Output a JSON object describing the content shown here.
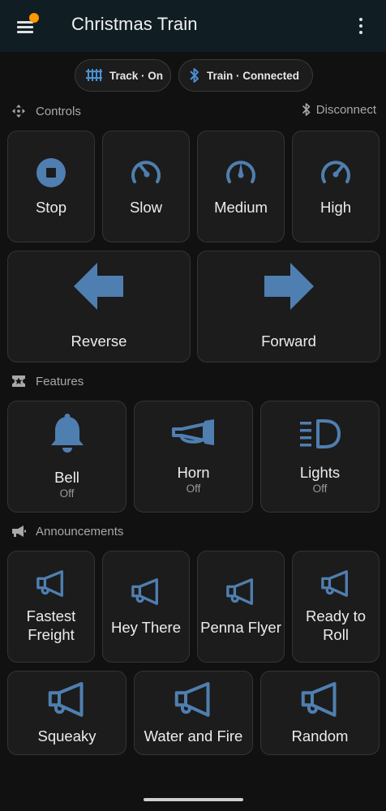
{
  "header": {
    "title": "Christmas Train"
  },
  "chips": {
    "track": {
      "label": "Track · On",
      "icon": "track-icon"
    },
    "train": {
      "label": "Train · Connected",
      "icon": "bluetooth-icon"
    }
  },
  "sections": {
    "controls": {
      "label": "Controls",
      "action": "Disconnect"
    },
    "features": {
      "label": "Features"
    },
    "announcements": {
      "label": "Announcements"
    }
  },
  "controls": {
    "speeds": [
      "Stop",
      "Slow",
      "Medium",
      "High"
    ],
    "directions": [
      "Reverse",
      "Forward"
    ]
  },
  "features": [
    {
      "label": "Bell",
      "state": "Off"
    },
    {
      "label": "Horn",
      "state": "Off"
    },
    {
      "label": "Lights",
      "state": "Off"
    }
  ],
  "announcements": {
    "row1": [
      "Fastest Freight",
      "Hey There",
      "Penna Flyer",
      "Ready to Roll"
    ],
    "row2": [
      "Squeaky",
      "Water and Fire",
      "Random"
    ]
  },
  "colors": {
    "accent": "#4f7fb0",
    "background": "#111111",
    "card": "#1c1c1c",
    "topbar": "#101e24",
    "badge": "#ff9800"
  }
}
